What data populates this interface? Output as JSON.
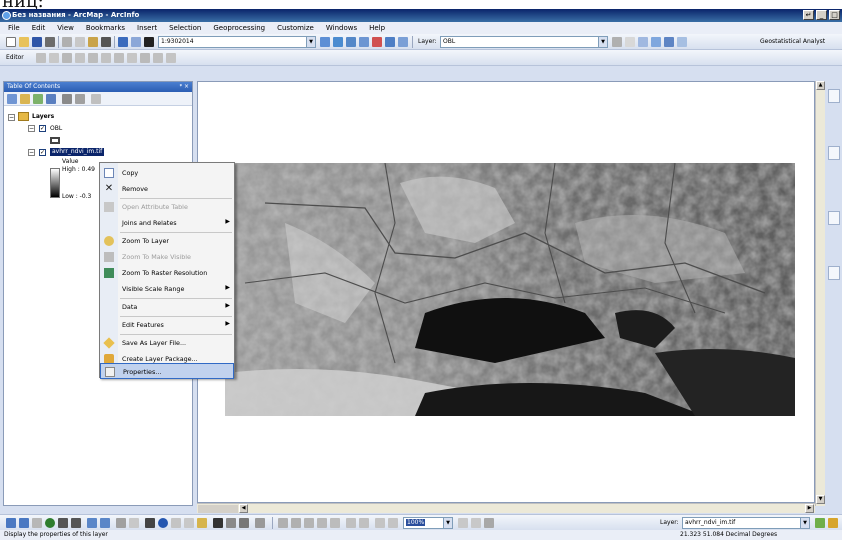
{
  "clip_text": "ниц:",
  "window": {
    "title": "Без названия - ArcMap - ArcInfo",
    "controls": [
      "↵",
      "_",
      "□",
      "×"
    ]
  },
  "menu": [
    "File",
    "Edit",
    "View",
    "Bookmarks",
    "Insert",
    "Selection",
    "Geoprocessing",
    "Customize",
    "Windows",
    "Help"
  ],
  "toolbar": {
    "scale": "1:9302014",
    "layer_label": "Layer:",
    "layer_value": "OBL",
    "geostat": "Geostatistical Analyst",
    "editor": "Editor"
  },
  "toc": {
    "title": "Table Of Contents",
    "title_controls": "ᵠ ×",
    "root": "Layers",
    "layer1": "OBL",
    "layer2": "avhrr_ndvi_im.tif",
    "value_label": "Value",
    "high": "High : 0.49",
    "low": "Low : -0.3"
  },
  "context_menu": {
    "copy": "Copy",
    "remove": "Remove",
    "open_attr": "Open Attribute Table",
    "joins": "Joins and Relates",
    "zoom_layer": "Zoom To Layer",
    "zoom_visible": "Zoom To Make Visible",
    "zoom_raster": "Zoom To Raster Resolution",
    "scale_range": "Visible Scale Range",
    "data": "Data",
    "edit_features": "Edit Features",
    "save_layer": "Save As Layer File...",
    "create_pkg": "Create Layer Package...",
    "properties": "Properties...",
    "submenu_arrow": "▶"
  },
  "bottom": {
    "zoom_pct": "100%",
    "layer_label": "Layer:",
    "layer_value": "avhrr_ndvi_im.tif"
  },
  "status": {
    "message": "Display the properties of this layer",
    "coords": "21.323  51.084 Decimal Degrees"
  }
}
